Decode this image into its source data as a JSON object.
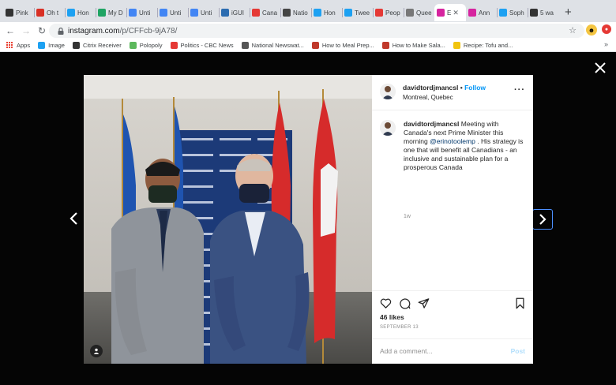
{
  "browser": {
    "tabs": [
      {
        "title": "Pink",
        "icon": "person-icon",
        "color": "#333333"
      },
      {
        "title": "Oh t",
        "icon": "gmail-icon",
        "color": "#d93025"
      },
      {
        "title": "Hon",
        "icon": "twitter-icon",
        "color": "#1da1f2"
      },
      {
        "title": "My D",
        "icon": "drive-icon",
        "color": "#1fa463"
      },
      {
        "title": "Unti",
        "icon": "docs-icon",
        "color": "#4285f4"
      },
      {
        "title": "Unti",
        "icon": "docs-icon",
        "color": "#4285f4"
      },
      {
        "title": "Unti",
        "icon": "docs-icon",
        "color": "#4285f4"
      },
      {
        "title": "iGUI",
        "icon": "igui-icon",
        "color": "#2b6cb0"
      },
      {
        "title": "Cana",
        "icon": "cbc-icon",
        "color": "#e53935"
      },
      {
        "title": "Natio",
        "icon": "national-icon",
        "color": "#444444"
      },
      {
        "title": "Hon",
        "icon": "twitter-icon",
        "color": "#1da1f2"
      },
      {
        "title": "Twee",
        "icon": "twitter-icon",
        "color": "#1da1f2"
      },
      {
        "title": "Peop",
        "icon": "cbc-icon",
        "color": "#e53935"
      },
      {
        "title": "Quee",
        "icon": "queen-icon",
        "color": "#777777"
      },
      {
        "title": "E",
        "icon": "instagram-icon",
        "color": "#d6249f",
        "active": true
      },
      {
        "title": "Ann",
        "icon": "instagram-icon",
        "color": "#d6249f"
      },
      {
        "title": "Soph",
        "icon": "twitter-icon",
        "color": "#1da1f2"
      },
      {
        "title": "5 wa",
        "icon": "book-icon",
        "color": "#333333"
      }
    ],
    "new_tab": "+",
    "url_host": "instagram.com",
    "url_path": "/p/CFFcb-9jA78/",
    "bookmarks": [
      {
        "label": "Apps",
        "icon": "apps-grid-icon"
      },
      {
        "label": "Image",
        "icon": "twitter-icon"
      },
      {
        "label": "Citrix Receiver",
        "icon": "citrix-icon"
      },
      {
        "label": "Polopoly",
        "icon": "polopoly-icon"
      },
      {
        "label": "Politics - CBC News",
        "icon": "cbc-icon"
      },
      {
        "label": "National Newswat...",
        "icon": "national-icon"
      },
      {
        "label": "How to Meal Prep...",
        "icon": "bookmark-site-icon"
      },
      {
        "label": "How to Make Sala...",
        "icon": "bookmark-site-icon"
      },
      {
        "label": "Recipe: Tofu and...",
        "icon": "recipe-icon"
      }
    ],
    "bookmarks_more": "»"
  },
  "post": {
    "username": "davidtordjmancsl",
    "follow_label": "Follow",
    "location": "Montreal, Quebec",
    "caption_user": "davidtordjmancsl",
    "caption_before": " Meeting with Canada's next Prime Minister this morning ",
    "caption_mention": "@erinotoolemp",
    "caption_after": " . His strategy is one that will benefit all Canadians - an inclusive and sustainable plan for a prosperous Canada",
    "time_ago": "1w",
    "likes": "46 likes",
    "date": "SEPTEMBER 13",
    "comment_placeholder": "Add a comment...",
    "post_label": "Post"
  },
  "colors": {
    "accent_blue": "#0095f6",
    "post_disabled": "#b2dffc",
    "overlay": "#050505"
  }
}
